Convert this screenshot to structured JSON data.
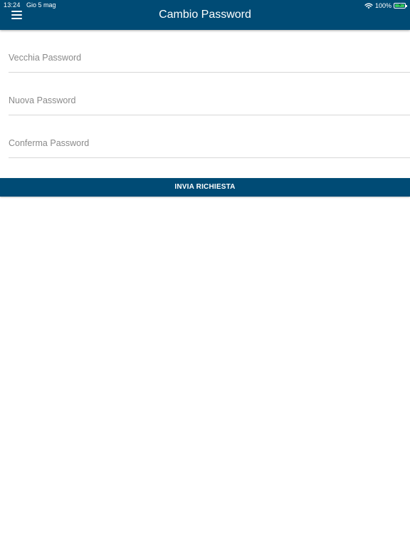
{
  "status_bar": {
    "time": "13:24",
    "date": "Gio 5 mag",
    "battery": "100%"
  },
  "header": {
    "title": "Cambio Password",
    "menu_icon": "hamburger-menu-icon"
  },
  "form": {
    "old_password": {
      "placeholder": "Vecchia Password",
      "value": ""
    },
    "new_password": {
      "placeholder": "Nuova Password",
      "value": ""
    },
    "confirm_password": {
      "placeholder": "Conferma Password",
      "value": ""
    },
    "submit_label": "INVIA RICHIESTA"
  },
  "colors": {
    "primary": "#004b75",
    "background": "#ffffff",
    "divider": "#d7d7d7",
    "battery_fill": "#34c759"
  }
}
